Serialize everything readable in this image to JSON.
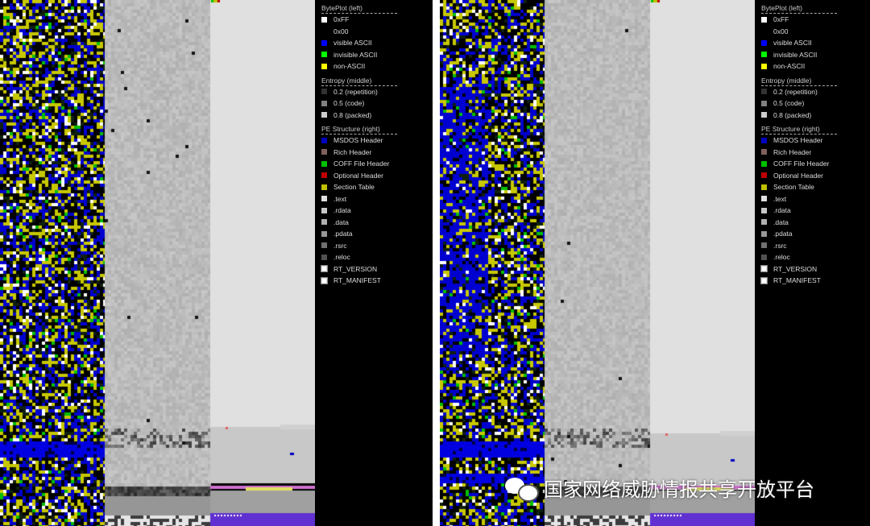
{
  "panels": [
    {
      "id": "file-1"
    },
    {
      "id": "file-2"
    }
  ],
  "legend": {
    "byteplot_title": "BytePlot (left)",
    "byteplot": [
      {
        "label": "0xFF",
        "color": "#ffffff"
      },
      {
        "label": "0x00",
        "color": "#000000"
      },
      {
        "label": "visible ASCII",
        "color": "#0000ff"
      },
      {
        "label": "invisible ASCII",
        "color": "#00ff00"
      },
      {
        "label": "non-ASCII",
        "color": "#ffff00"
      }
    ],
    "entropy_title": "Entropy (middle)",
    "entropy": [
      {
        "label": "0.2 (repetition)",
        "color": "#333333"
      },
      {
        "label": "0.5 (code)",
        "color": "#808080"
      },
      {
        "label": "0.8 (packed)",
        "color": "#cccccc"
      }
    ],
    "pe_title": "PE Structure (right)",
    "pe": [
      {
        "label": "MSDOS Header",
        "color": "#0000c0"
      },
      {
        "label": "Rich Header",
        "color": "#806060"
      },
      {
        "label": "COFF File Header",
        "color": "#00c000"
      },
      {
        "label": "Optional Header",
        "color": "#c00000"
      },
      {
        "label": "Section Table",
        "color": "#c0c000"
      },
      {
        "label": ".text",
        "color": "#e0e0e0"
      },
      {
        "label": ".rdata",
        "color": "#c8c8c8"
      },
      {
        "label": ".data",
        "color": "#b0b0b0"
      },
      {
        "label": ".pdata",
        "color": "#989898"
      },
      {
        "label": ".rsrc",
        "color": "#707070"
      },
      {
        "label": ".reloc",
        "color": "#505050"
      },
      {
        "label": "RT_VERSION",
        "color": "#c0c0c0",
        "boxed": true
      },
      {
        "label": "RT_MANIFEST",
        "color": "#c0c0c0",
        "boxed": true
      }
    ]
  },
  "watermark": "国家网络威胁情报共享开放平台"
}
